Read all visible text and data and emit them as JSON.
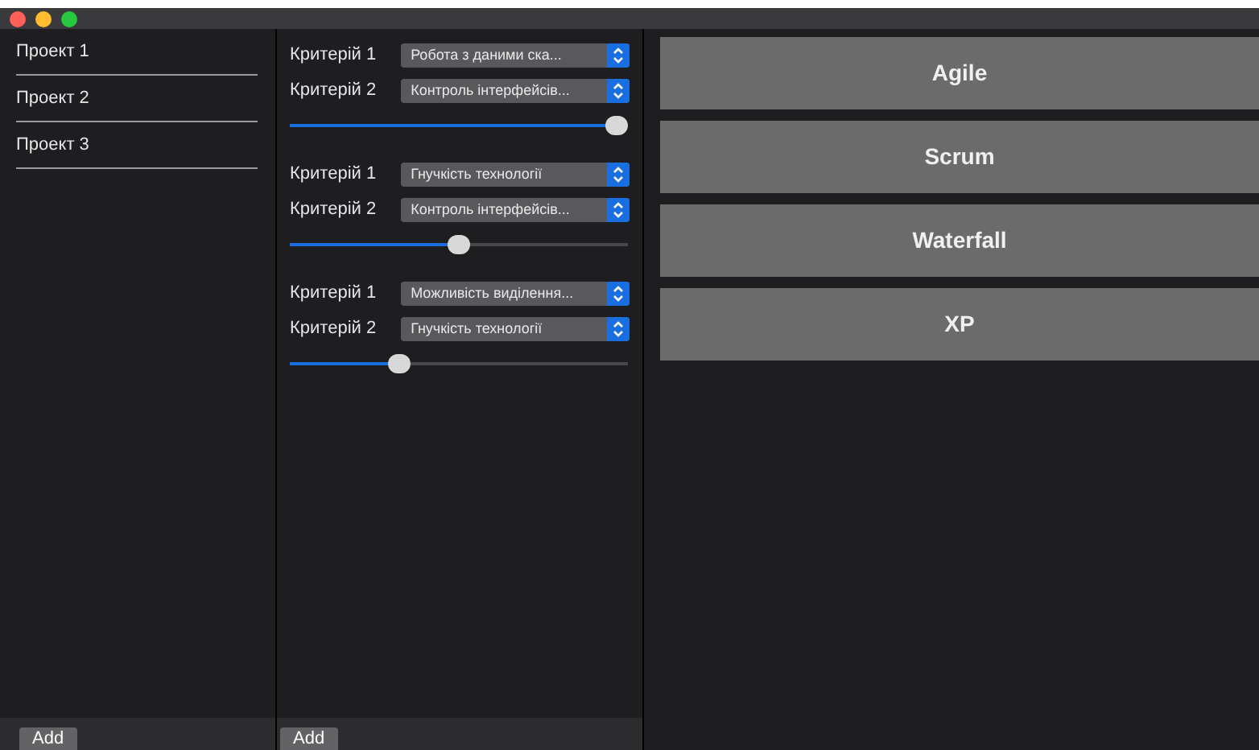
{
  "projects": [
    {
      "label": "Проект 1"
    },
    {
      "label": "Проект 2"
    },
    {
      "label": "Проект 3"
    }
  ],
  "criteria_groups": [
    {
      "criteria": [
        {
          "label": "Критерій 1",
          "value": "Робота з даними ска..."
        },
        {
          "label": "Критерій 2",
          "value": "Контроль інтерфейсів..."
        }
      ],
      "level": 1
    },
    {
      "criteria": [
        {
          "label": "Критерій 1",
          "value": "Гнучкість технології"
        },
        {
          "label": "Критерій 2",
          "value": "Контроль інтерфейсів..."
        }
      ],
      "level": 0.5
    },
    {
      "criteria": [
        {
          "label": "Критерій 1",
          "value": "Можливість виділення..."
        },
        {
          "label": "Критерій 2",
          "value": "Гнучкість технології"
        }
      ],
      "level": 0.31
    }
  ],
  "methodologies": [
    {
      "label": "Agile"
    },
    {
      "label": "Scrum"
    },
    {
      "label": "Waterfall"
    },
    {
      "label": "XP"
    }
  ],
  "bottom_buttons": [
    {
      "label": "Add"
    },
    {
      "label": "Add"
    }
  ]
}
